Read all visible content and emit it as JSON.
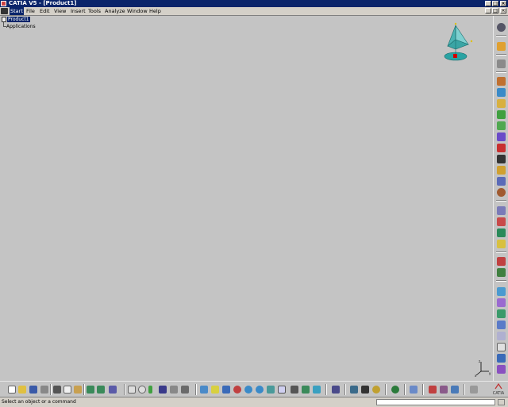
{
  "window": {
    "title": "CATIA V5 - [Product1]",
    "minimize_label": "_",
    "maximize_label": "□",
    "close_label": "×",
    "doc_minimize_label": "_",
    "doc_restore_label": "□",
    "doc_close_label": "×"
  },
  "menu": {
    "items": [
      "Start",
      "File",
      "Edit",
      "View",
      "Insert",
      "Tools",
      "Analyze",
      "Window",
      "Help"
    ],
    "active": "Start"
  },
  "tree": {
    "root_label": "Product1",
    "child_label": "Applications"
  },
  "right_toolbar": {
    "icons": [
      "chain-icon",
      "sketch-icon",
      "cube-icon",
      "catalog-icon",
      "insert-component-icon",
      "insert-product-icon",
      "insert-part-icon",
      "existing-component-icon",
      "replace-component-icon",
      "graph-tree-icon",
      "generate-numbering-icon",
      "multi-instantiation-icon",
      "fast-multi-instantiation-icon",
      "manipulation-icon",
      "snap-icon",
      "explode-icon",
      "stop-manipulate-icon",
      "coincidence-constraint-icon",
      "contact-constraint-icon",
      "offset-constraint-icon",
      "angle-constraint-icon",
      "fix-component-icon",
      "fix-together-icon",
      "quick-constraint-icon",
      "flexible-rigid-icon",
      "update-icon"
    ]
  },
  "bottom_toolbar": {
    "icons": [
      "new-icon",
      "open-icon",
      "save-icon",
      "print-icon",
      "cut-icon",
      "copy-icon",
      "paste-icon",
      "undo-icon",
      "redo-icon",
      "whats-this-icon",
      "formula-icon",
      "comment-icon",
      "knowledge-icon",
      "table-icon",
      "hide-show-icon",
      "swap-icon",
      "fly-mode-icon",
      "fit-all-icon",
      "pan-icon",
      "rotate-icon",
      "zoom-in-icon",
      "zoom-out-icon",
      "normal-view-icon",
      "multi-view-icon",
      "iso-view-icon",
      "shading-icon",
      "hide-icon",
      "measure-icon",
      "space-analysis-icon",
      "clash-icon",
      "sectioning-icon",
      "distance-icon",
      "catalog-browser-icon",
      "tools-icon",
      "render-icon",
      "grid-icon"
    ],
    "brand_text": "CATIA"
  },
  "status": {
    "message": "Select an object or a command",
    "command_value": ""
  },
  "colors": {
    "titlebar": "#0a246a",
    "workspace": "#c4c4c4",
    "selection": "#0a246a",
    "compass_teal": "#2aa3a3"
  }
}
